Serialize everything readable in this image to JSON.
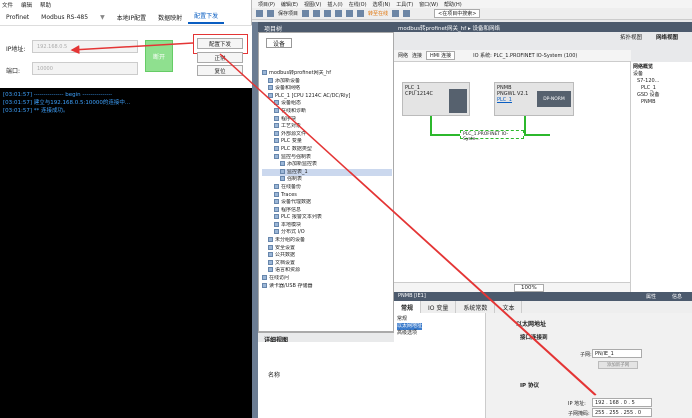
{
  "left_app": {
    "menu": [
      "文件",
      "编辑",
      "帮助"
    ],
    "tabs": [
      "Profinet",
      "Modbus RS-485",
      "▼",
      "本地IP配置",
      "数据映射",
      "配置下发"
    ],
    "active_tab_index": 5,
    "ip_label": "IP地址:",
    "ip_placeholder": "192.168.0.5",
    "port_label": "端口:",
    "port_placeholder": "10000",
    "open_button": "断开",
    "config_download_button": "配置下发",
    "normal_button": "正常",
    "reset_button": "复位",
    "console_lines": [
      "[03:01:57] --------------- begin ---------------",
      "[03:01:57] 建立与192.168.0.5:10000的连接中...",
      "[03:01:57] ** 连接成功。"
    ]
  },
  "tia": {
    "menu": [
      "项目(P)",
      "编辑(E)",
      "视图(V)",
      "插入(I)",
      "在线(O)",
      "选项(N)",
      "工具(T)",
      "窗口(W)",
      "帮助(H)"
    ],
    "toolbar_save": "保存项目",
    "toolbar_online": "转至在线",
    "toolbar_search": "<在项目中搜索>",
    "project_tree_title": "项目树",
    "devices_tab": "设备",
    "tree": [
      "modbus转profinet网关_hf",
      "添加新设备",
      "设备和网络",
      "PLC_1 [CPU 1214C AC/DC/Rly]",
      "设备组态",
      "在线和诊断",
      "程序块",
      "工艺对象",
      "外部源文件",
      "PLC 变量",
      "PLC 数据类型",
      "监控与强制表",
      "添加新监控表",
      "监控表_1",
      "强制表",
      "在线备份",
      "Traces",
      "设备代理数据",
      "程序信息",
      "PLC 报警文本列表",
      "本地模块",
      "分布式 I/O",
      "未分组的设备",
      "安全设置",
      "公共数据",
      "文档设置",
      "语言和资源",
      "在线访问",
      "读卡器/USB 存储器"
    ],
    "detail_view": "详细视图",
    "detail_name_col": "名称",
    "title_path": "modbus转profinet网关_hf ▸ 设备和网络",
    "view_topology": "拓扑视图",
    "view_network": "网络视图",
    "net_tool_network": "网络",
    "net_tool_connect": "连接",
    "net_tool_hmi": "HMI 连接",
    "io_system_label": "IO 系统: PLC_1.PROFINET IO-System (100)",
    "device_plc_name": "PLC_1",
    "device_plc_type": "CPU 1214C",
    "device_gw_name": "PNMB",
    "device_gw_type": "PNGWL V2.1",
    "device_gw_link": "PLC_1",
    "gw_module_label": "DP-NORM",
    "io_system_bus_label": "PLC_1.PROFINET IO-Syste...",
    "zoom": "100%",
    "props_title": "PNMB [IE1]",
    "props_tab_attr": "属性",
    "props_tab_info": "信息",
    "props_tabs": [
      "常规",
      "IO 变量",
      "系统常数",
      "文本"
    ],
    "props_nav": [
      "常规",
      "以太网地址",
      "高级选项"
    ],
    "section_ethernet": "以太网地址",
    "section_interface": "接口连接到",
    "subnet_label": "子网:",
    "subnet_value": "PN/IE_1",
    "add_subnet_button": "添加新子网",
    "section_ip": "IP 协议",
    "ip_addr_label": "IP 地址:",
    "ip_addr_value": "192 . 168 . 0 . 5",
    "mask_label": "子网掩码:",
    "mask_value": "255 . 255 . 255 . 0",
    "catalog_title": "网络概览",
    "catalog_items": [
      "设备",
      "S7-120...",
      "PLC_1",
      "GSD 设备",
      "PNMB"
    ]
  },
  "colors": {
    "accent_red": "#e43535",
    "console_text": "#3fa3ff",
    "tia_header": "#4c5a6d",
    "open_button": "#8fe08f"
  }
}
